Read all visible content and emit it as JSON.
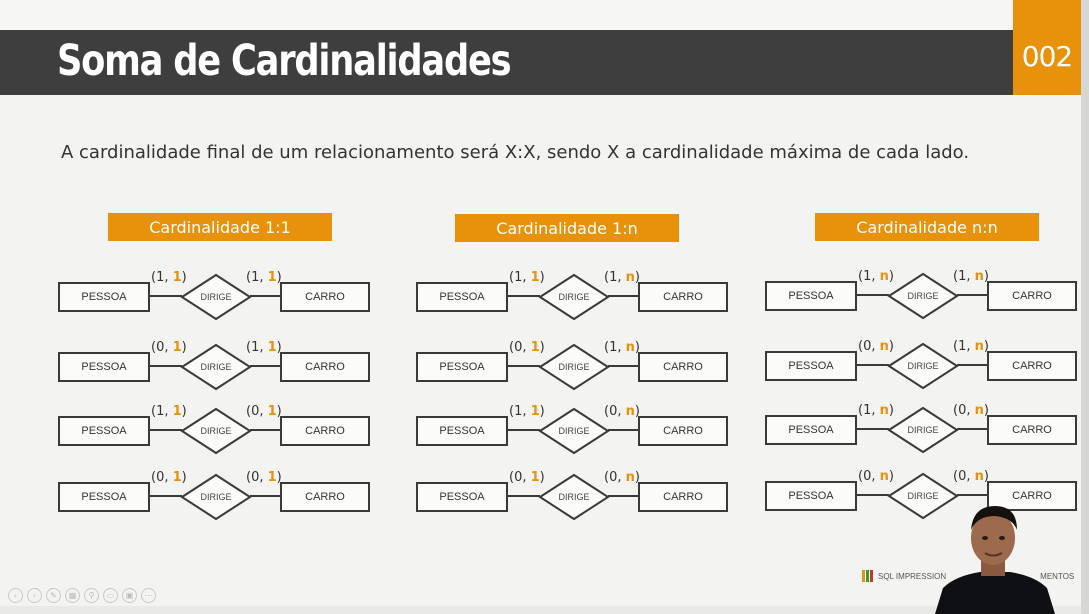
{
  "slide": {
    "title": "Soma de Cardinalidades",
    "number": "002",
    "subtitle": "A cardinalidade final de um relacionamento será X:X, sendo X a cardinalidade máxima de cada lado."
  },
  "columns": [
    {
      "label": "Cardinalidade 1:1",
      "rows": [
        {
          "left": {
            "min": "1",
            "max": "1"
          },
          "right": {
            "min": "1",
            "max": "1"
          }
        },
        {
          "left": {
            "min": "0",
            "max": "1"
          },
          "right": {
            "min": "1",
            "max": "1"
          }
        },
        {
          "left": {
            "min": "1",
            "max": "1"
          },
          "right": {
            "min": "0",
            "max": "1"
          }
        },
        {
          "left": {
            "min": "0",
            "max": "1"
          },
          "right": {
            "min": "0",
            "max": "1"
          }
        }
      ]
    },
    {
      "label": "Cardinalidade 1:n",
      "rows": [
        {
          "left": {
            "min": "1",
            "max": "1"
          },
          "right": {
            "min": "1",
            "max": "n"
          }
        },
        {
          "left": {
            "min": "0",
            "max": "1"
          },
          "right": {
            "min": "1",
            "max": "n"
          }
        },
        {
          "left": {
            "min": "1",
            "max": "1"
          },
          "right": {
            "min": "0",
            "max": "n"
          }
        },
        {
          "left": {
            "min": "0",
            "max": "1"
          },
          "right": {
            "min": "0",
            "max": "n"
          }
        }
      ]
    },
    {
      "label": "Cardinalidade n:n",
      "rows": [
        {
          "left": {
            "min": "1",
            "max": "n"
          },
          "right": {
            "min": "1",
            "max": "n"
          }
        },
        {
          "left": {
            "min": "0",
            "max": "n"
          },
          "right": {
            "min": "1",
            "max": "n"
          }
        },
        {
          "left": {
            "min": "1",
            "max": "n"
          },
          "right": {
            "min": "0",
            "max": "n"
          }
        },
        {
          "left": {
            "min": "0",
            "max": "n"
          },
          "right": {
            "min": "0",
            "max": "n"
          }
        }
      ]
    }
  ],
  "entities": {
    "left": "PESSOA",
    "right": "CARRO"
  },
  "relationship": "DIRIGE",
  "brand": "SQL IMPRESSION",
  "brand_suffix": "MENTOS",
  "colors": {
    "accent": "#e8910b",
    "titlebar": "#3e3e3e",
    "stroke": "#3a3a3a"
  },
  "toolbar_icons": [
    "prev-icon",
    "next-icon",
    "pen-icon",
    "grid-icon",
    "zoom-icon",
    "subtitles-icon",
    "screen-icon",
    "more-icon"
  ]
}
